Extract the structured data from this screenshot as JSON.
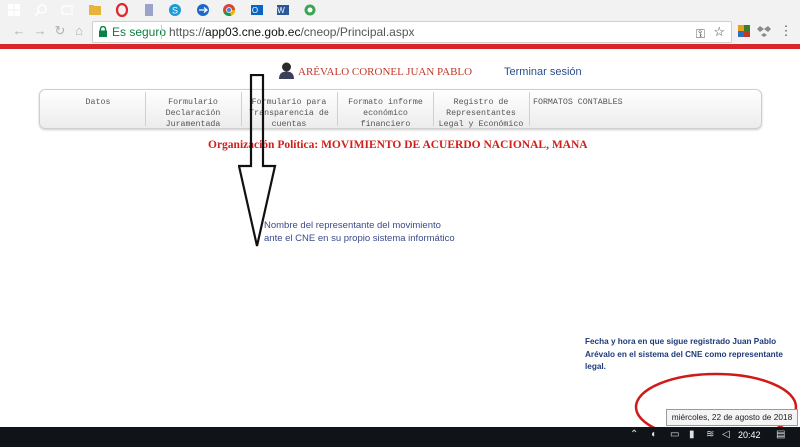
{
  "browser": {
    "secure_label": "Es seguro",
    "url_scheme": "https://",
    "url_host": "app03.cne.gob.ec",
    "url_path": "/cneop/Principal.aspx"
  },
  "header": {
    "user_name": "ARÉVALO CORONEL JUAN PABLO",
    "logout_label": "Terminar sesión"
  },
  "menu": {
    "items": [
      {
        "label": "Datos"
      },
      {
        "label": "Formulario\nDeclaración\nJuramentada"
      },
      {
        "label": "Formulario para\nTransparencia de\ncuentas"
      },
      {
        "label": "Formato informe\neconómico\nfinanciero"
      },
      {
        "label": "Registro de\nRepresentantes\nLegal y Económico"
      },
      {
        "label": "FORMATOS CONTABLES"
      }
    ]
  },
  "organization": {
    "label": "Organización Política: MOVIMIENTO DE ACUERDO NACIONAL, MANA"
  },
  "annotations": {
    "note_representative": "Nombre del representante del movimiento\n ante el CNE en su propio sistema informático",
    "note_datetime": "Fecha y hora en que sigue registrado Juan Pablo Arévalo en el sistema del CNE como representante legal."
  },
  "tooltip": {
    "date": "miércoles, 22 de agosto de 2018"
  },
  "taskbar": {
    "time": "20:42"
  },
  "colors": {
    "accent_red": "#d8262b",
    "annotation_blue": "#1e3a7a"
  }
}
